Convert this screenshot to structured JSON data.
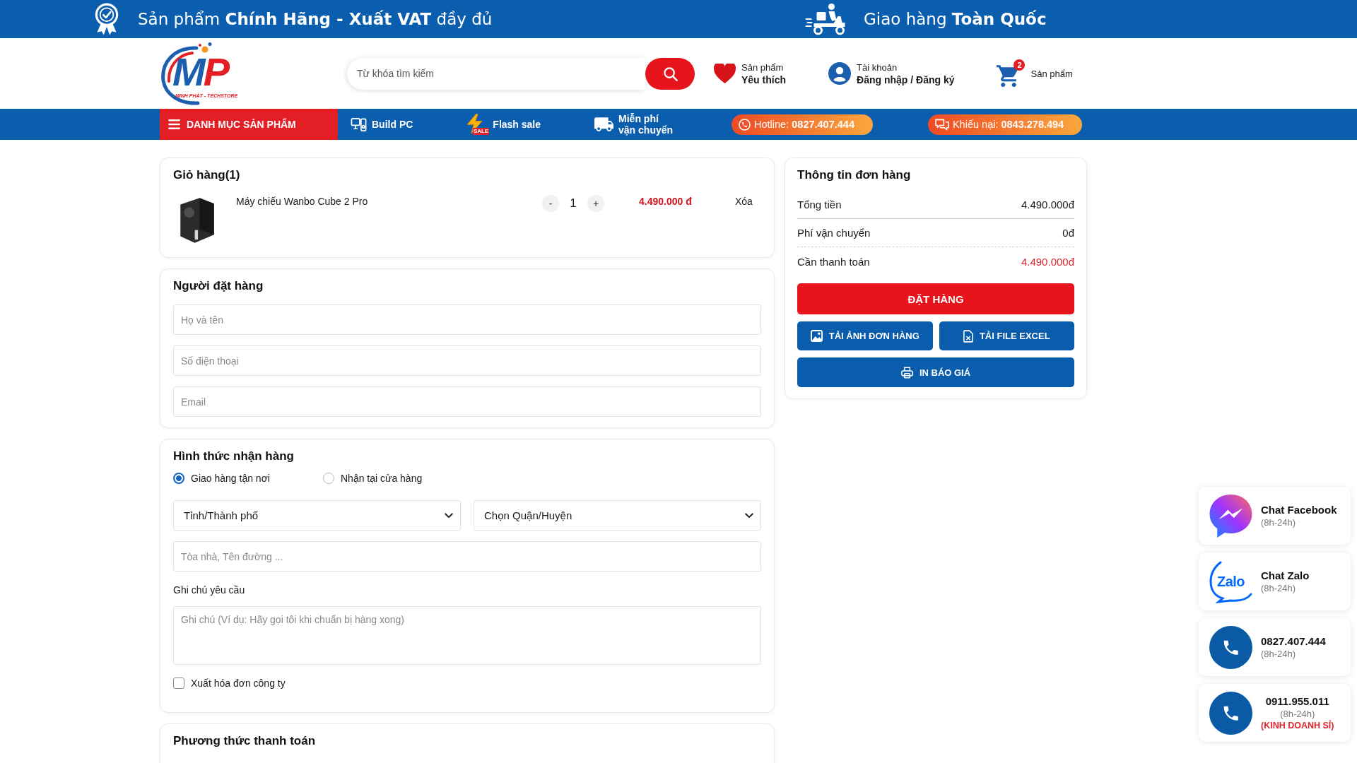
{
  "promo_bar": {
    "items": [
      {
        "kind": "certified",
        "text": "Sản phẩm **Chính Hãng - Xuất VAT** đầy đủ"
      },
      {
        "kind": "delivery",
        "text": "Giao hàng **Toàn Quốc**"
      }
    ]
  },
  "header": {
    "logo": {
      "monogram": [
        "M",
        "P"
      ],
      "tagline": "MINH PHÁT - TECHSTORE"
    },
    "search": {
      "placeholder": "Từ khóa tìm kiếm"
    },
    "links": [
      {
        "kind": "wishlist",
        "line1": "Sản phẩm",
        "line2": "Yêu thích"
      },
      {
        "kind": "account",
        "line1": "Tài khoản",
        "line2": "Đăng nhập / Đăng ký"
      },
      {
        "kind": "cart",
        "badge": "2",
        "line1": "Sản phẩm"
      }
    ]
  },
  "nav": {
    "menu": "DANH MỤC SẢN PHẨM",
    "links": [
      {
        "kind": "build",
        "label": "Build PC"
      },
      {
        "kind": "flash",
        "label": "Flash sale",
        "tag": "SALE"
      },
      {
        "kind": "shipping",
        "label": "Miễn phí vận chuyển"
      }
    ],
    "contacts": [
      {
        "kind": "phone",
        "text": "Hotline: **0827.407.444**"
      },
      {
        "kind": "chat",
        "text": "Khiếu nại: **0843.278.494**"
      }
    ]
  },
  "cart": {
    "title": "Giỏ hàng(1)",
    "items": [
      {
        "name": "Máy chiếu Wanbo Cube 2 Pro",
        "decrement": "-",
        "quantity": "1",
        "increment": "+",
        "price": "4.490.000 đ",
        "remove": "Xóa"
      }
    ]
  },
  "buyer": {
    "title": "Người đặt hàng",
    "fields": [
      {
        "placeholder": "Họ và tên"
      },
      {
        "placeholder": "Số điện thoại"
      },
      {
        "placeholder": "Email"
      }
    ]
  },
  "delivery": {
    "title": "Hình thức nhận hàng",
    "options": [
      {
        "label": "Giao hàng tận nơi",
        "selected": true
      },
      {
        "label": "Nhận tại cửa hàng",
        "selected": false
      }
    ],
    "selects": [
      {
        "value": "Tỉnh/Thành phố"
      },
      {
        "value": "Chọn Quận/Huyện"
      }
    ],
    "address": {
      "placeholder": "Tòa nhà, Tên đường ..."
    },
    "note": {
      "label": "Ghi chú yêu cầu",
      "placeholder": "Ghi chú (Ví dụ: Hãy gọi tôi khi chuẩn bị hàng xong)"
    },
    "invoice": {
      "label": "Xuất hóa đơn công ty",
      "checked": false
    }
  },
  "payment": {
    "title": "Phương thức thanh toán"
  },
  "order_summary": {
    "title": "Thông tin đơn hàng",
    "rows": [
      {
        "kind": "total",
        "label": "Tổng tiền",
        "value": "4.490.000đ"
      },
      {
        "kind": "fee",
        "label": "Phí vận chuyển",
        "value": "0đ"
      },
      {
        "kind": "due",
        "label": "Cần thanh toán",
        "value": "4.490.000đ"
      }
    ],
    "buttons": [
      {
        "kind": "order",
        "label": "ĐẶT HÀNG"
      },
      {
        "kind": "image",
        "label": "TẢI ẢNH ĐƠN HÀNG"
      },
      {
        "kind": "excel",
        "label": "TẢI FILE EXCEL"
      },
      {
        "kind": "print",
        "label": "IN BÁO GIÁ"
      }
    ]
  },
  "floating_contacts": [
    {
      "kind": "messenger",
      "title": "Chat Facebook",
      "hours": "(8h-24h)"
    },
    {
      "kind": "zalo",
      "logo_text": "Zalo",
      "title": "Chat Zalo",
      "hours": "(8h-24h)"
    },
    {
      "kind": "phone",
      "title": "0827.407.444",
      "hours": "(8h-24h)"
    },
    {
      "kind": "phone",
      "title": "0911.955.011",
      "hours": "(8h-24h)",
      "note": "(KINH DOANH SỈ)"
    }
  ]
}
